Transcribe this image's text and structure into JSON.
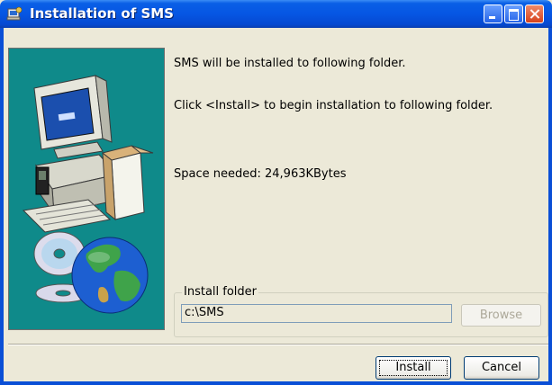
{
  "window": {
    "title": "Installation of SMS",
    "icon": "installer-icon",
    "controls": [
      "minimize-icon",
      "maximize-icon",
      "close-icon"
    ]
  },
  "content": {
    "line1": "SMS will be installed to following folder.",
    "line2": "Click <Install> to begin installation to following folder.",
    "space_needed": "Space needed: 24,963KBytes"
  },
  "install_folder": {
    "label": "Install folder",
    "value": "c:\\SMS",
    "browse_label": "Browse",
    "browse_enabled": false
  },
  "buttons": {
    "install_label": "Install",
    "cancel_label": "Cancel"
  },
  "colors": {
    "titlebar": "#0656e3",
    "side_panel": "#0f8a8a",
    "dialog_bg": "#ece9d8"
  }
}
